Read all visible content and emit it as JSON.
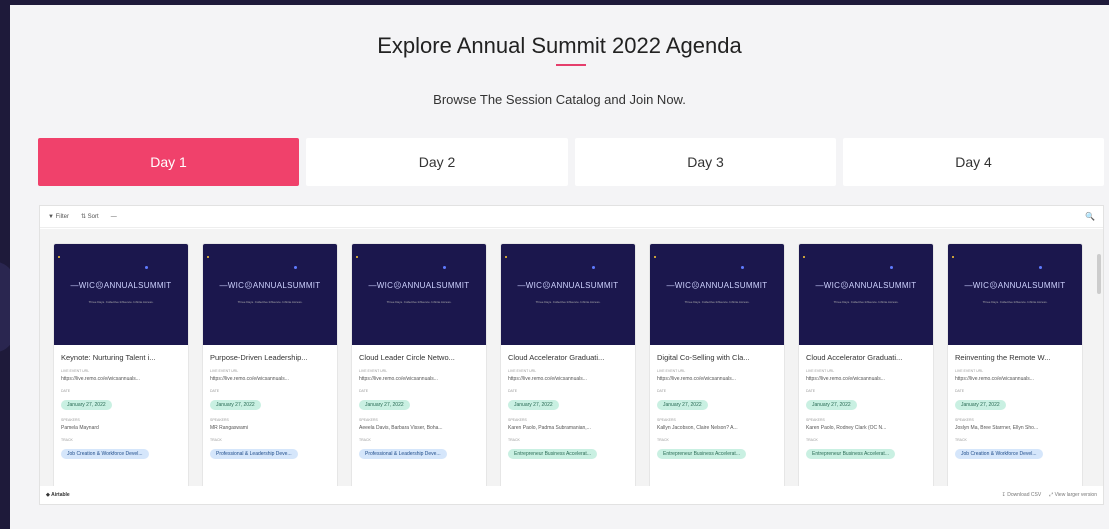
{
  "page": {
    "title": "Explore Annual Summit 2022 Agenda",
    "subtitle": "Browse The Session Catalog and Join Now.",
    "accent": "#f0416b"
  },
  "tabs": [
    {
      "label": "Day 1",
      "active": true
    },
    {
      "label": "Day 2",
      "active": false
    },
    {
      "label": "Day 3",
      "active": false
    },
    {
      "label": "Day 4",
      "active": false
    }
  ],
  "toolbar": {
    "filter_label": "Filter",
    "sort_label": "Sort",
    "more_label": "—",
    "search_icon": "search-icon"
  },
  "card_common": {
    "logo": "—WIC☹ANNUALSUMMIT",
    "tagline": "Three Days. Collective Influence. Infinite Access.",
    "url_label": "LIVE EVENT URL",
    "date_label": "DATE",
    "speakers_label": "SPEAKERS",
    "track_label": "TRACK"
  },
  "cards": [
    {
      "title": "Keynote: Nurturing Talent i...",
      "url": "https://live.remo.co/e/wicsannuals...",
      "date": "January 27, 2022",
      "speakers": "Pamela Maynard",
      "track": "Job Creation & Workforce Devel...",
      "track_color": "blue"
    },
    {
      "title": "Purpose-Driven Leadership...",
      "url": "https://live.remo.co/e/wicsannuals...",
      "date": "January 27, 2022",
      "speakers": "MR Rangaswami",
      "track": "Professional & Leadership Deve...",
      "track_color": "blue"
    },
    {
      "title": "Cloud Leader Circle Netwo...",
      "url": "https://live.remo.co/e/wicsannuals...",
      "date": "January 27, 2022",
      "speakers": "Aeeela Davis, Barbara Visser, Boha...",
      "track": "Professional & Leadership Deve...",
      "track_color": "blue"
    },
    {
      "title": "Cloud Accelerator Graduati...",
      "url": "https://live.remo.co/e/wicsannuals...",
      "date": "January 27, 2022",
      "speakers": "Karen Paolo, Padma Subramanian,...",
      "track": "Entrepreneur Business Accelerat...",
      "track_color": "green"
    },
    {
      "title": "Digital Co-Selling with Cla...",
      "url": "https://live.remo.co/e/wicsannuals...",
      "date": "January 27, 2022",
      "speakers": "Kallyn Jacobson, Claire Nelson? A...",
      "track": "Entrepreneur Business Accelerat...",
      "track_color": "green"
    },
    {
      "title": "Cloud Accelerator Graduati...",
      "url": "https://live.remo.co/e/wicsannuals...",
      "date": "January 27, 2022",
      "speakers": "Karen Paolo, Rodney Clark (OC N...",
      "track": "Entrepreneur Business Accelerat...",
      "track_color": "green"
    },
    {
      "title": "Reinventing the Remote W...",
      "url": "https://live.remo.co/e/wicsannuals...",
      "date": "January 27, 2022",
      "speakers": "Joslyn Ma, Bree Starrner, Ellyn Sho...",
      "track": "Job Creation & Workforce Devel...",
      "track_color": "blue"
    }
  ],
  "footer": {
    "brand": "Airtable",
    "download": "Download CSV",
    "view_larger": "View larger version"
  }
}
